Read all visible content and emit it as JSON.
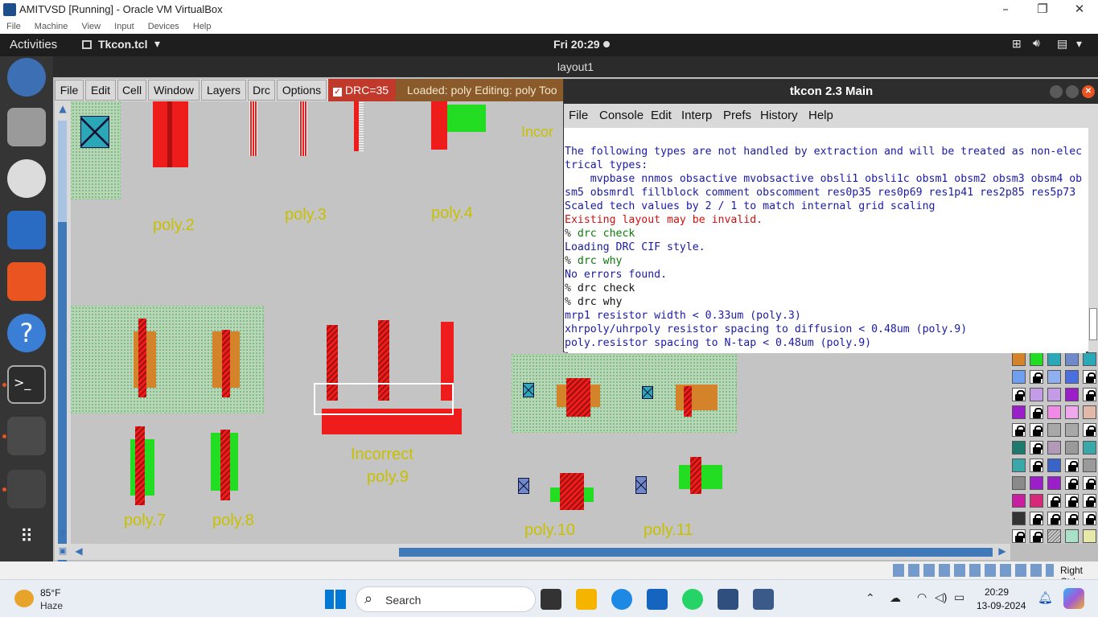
{
  "host": {
    "title": "AMITVSD [Running] - Oracle VM VirtualBox",
    "menu": [
      "File",
      "Machine",
      "View",
      "Input",
      "Devices",
      "Help"
    ],
    "status_right": "Right Ctrl"
  },
  "ubuntu": {
    "activities": "Activities",
    "app_name": "Tkcon.tcl",
    "clock": "Fri 20:29"
  },
  "magic": {
    "window_title": "layout1",
    "menu": [
      "File",
      "Edit",
      "Cell",
      "Window",
      "Layers",
      "Drc",
      "Options"
    ],
    "drc_label": "DRC=35",
    "loaded_text": "Loaded: poly Editing: poly Too",
    "labels": {
      "poly2": "poly.2",
      "poly3": "poly.3",
      "poly4": "poly.4",
      "poly7": "poly.7",
      "poly8": "poly.8",
      "incorrect1": "Incorrect",
      "incorrect2": "poly.9",
      "poly10": "poly.10",
      "poly11": "poly.11",
      "partial": "Incor"
    }
  },
  "tkcon": {
    "title": "tkcon 2.3 Main",
    "menu": [
      "File",
      "Console",
      "Edit",
      "Interp",
      "Prefs",
      "History",
      "Help"
    ],
    "lines": [
      "The following types are not handled by extraction and will be treated as non-elec",
      "trical types:",
      "    mvpbase nnmos obsactive mvobsactive obsli1 obsli1c obsm1 obsm2 obsm3 obsm4 ob",
      "sm5 obsmrdl fillblock comment obscomment res0p35 res0p69 res1p41 res2p85 res5p73",
      "Scaled tech values by 2 / 1 to match internal grid scaling",
      "Existing layout may be invalid.",
      "drc check",
      "Loading DRC CIF style.",
      "drc why",
      "No errors found.",
      "drc check",
      "drc why",
      "mrp1 resistor width < 0.33um (poly.3)",
      "xhrpoly/uhrpoly resistor spacing to diffusion < 0.48um (poly.9)",
      "poly.resistor spacing to N-tap < 0.48um (poly.9)",
      ""
    ],
    "prompt": "%"
  },
  "taskbar": {
    "weather_temp": "85°F",
    "weather_desc": "Haze",
    "search": "Search",
    "time": "20:29",
    "date": "13-09-2024"
  }
}
